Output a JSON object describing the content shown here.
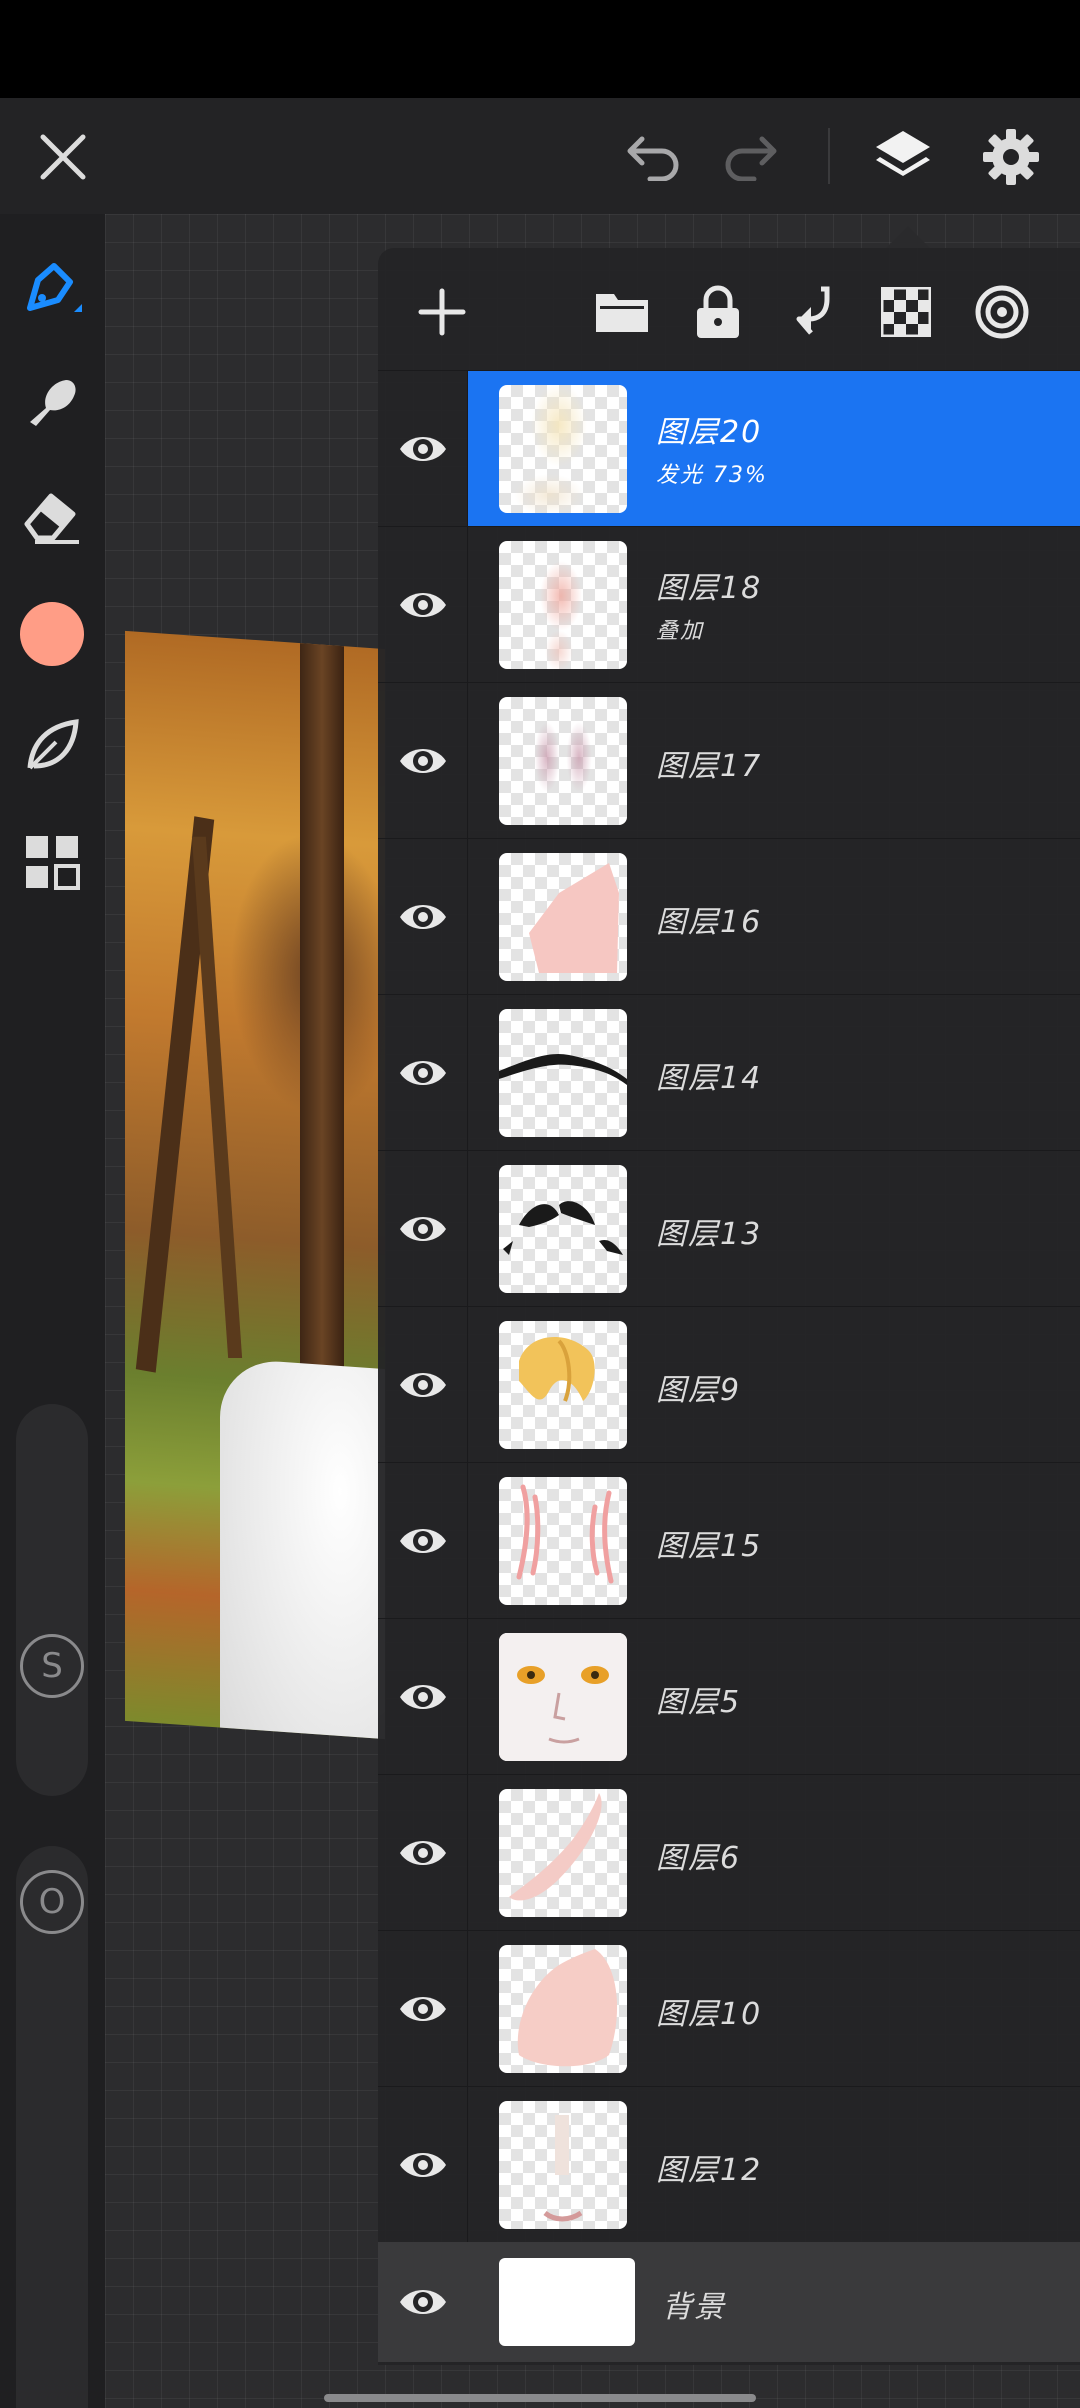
{
  "colors": {
    "accent": "#1b74f2",
    "brush_color": "#ff9d86",
    "panel_bg": "#242426",
    "icon": "#dcdcdc"
  },
  "top_toolbar": {
    "close_icon": "close-icon",
    "undo_icon": "undo-icon",
    "redo_icon": "redo-icon",
    "layers_icon": "layers-icon",
    "settings_icon": "gear-icon"
  },
  "left_toolbar": {
    "tools": [
      "brush-icon",
      "smudge-icon",
      "eraser-icon",
      "color-swatch",
      "leaf-icon",
      "grid-icon"
    ],
    "size_label": "S",
    "opacity_label": "O"
  },
  "layers_panel": {
    "header_actions": [
      "add-icon",
      "folder-icon",
      "lock-icon",
      "merge-down-icon",
      "checker-icon",
      "target-icon"
    ],
    "layers": [
      {
        "name": "图层20",
        "sub": "发光   73%",
        "selected": true
      },
      {
        "name": "图层18",
        "sub": "叠加",
        "selected": false
      },
      {
        "name": "图层17",
        "sub": "",
        "selected": false
      },
      {
        "name": "图层16",
        "sub": "",
        "selected": false
      },
      {
        "name": "图层14",
        "sub": "",
        "selected": false
      },
      {
        "name": "图层13",
        "sub": "",
        "selected": false
      },
      {
        "name": "图层9",
        "sub": "",
        "selected": false
      },
      {
        "name": "图层15",
        "sub": "",
        "selected": false
      },
      {
        "name": "图层5",
        "sub": "",
        "selected": false
      },
      {
        "name": "图层6",
        "sub": "",
        "selected": false
      },
      {
        "name": "图层10",
        "sub": "",
        "selected": false
      },
      {
        "name": "图层12",
        "sub": "",
        "selected": false
      }
    ],
    "background": {
      "name": "背景"
    }
  }
}
